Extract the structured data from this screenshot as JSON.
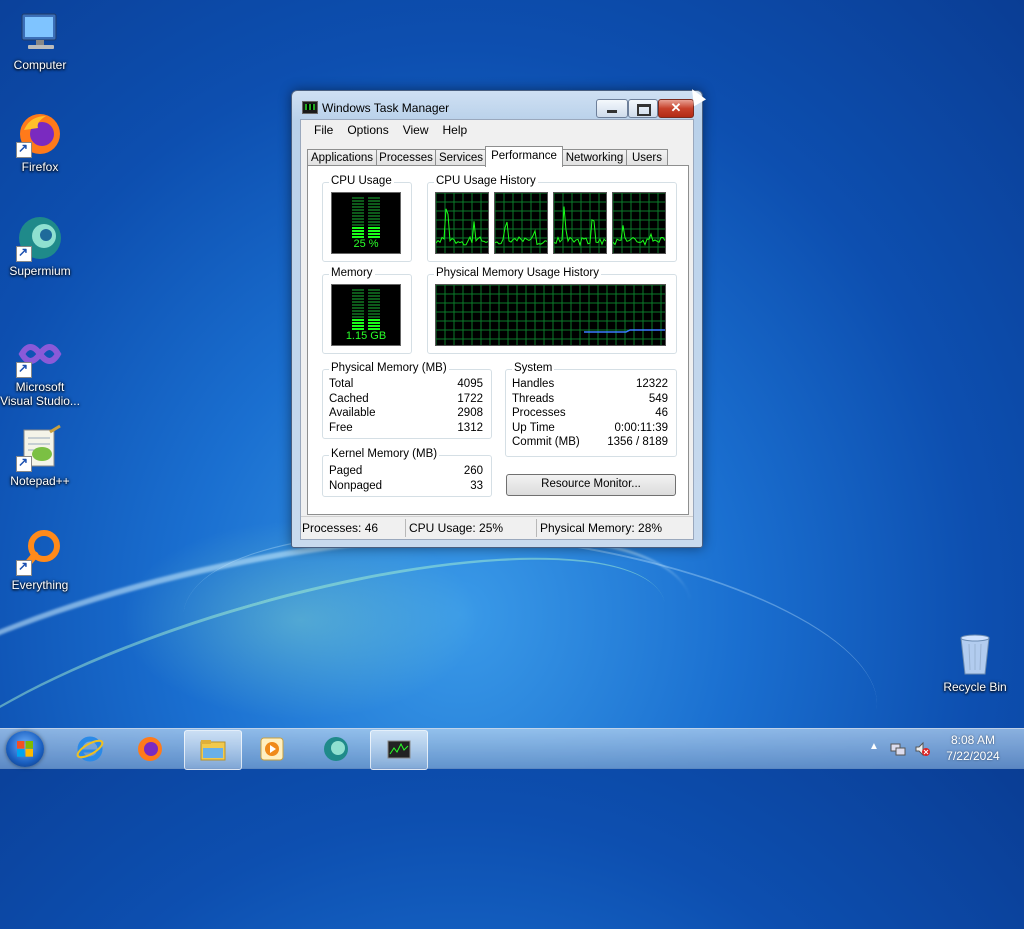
{
  "desktop": {
    "icons": [
      {
        "label": "Computer"
      },
      {
        "label": "Firefox"
      },
      {
        "label": "Supermium"
      },
      {
        "label": "Microsoft Visual Studio..."
      },
      {
        "label": "Notepad++"
      },
      {
        "label": "Everything"
      },
      {
        "label": "Recycle Bin"
      }
    ]
  },
  "window": {
    "title": "Windows Task Manager",
    "menu": [
      "File",
      "Options",
      "View",
      "Help"
    ],
    "tabs": [
      "Applications",
      "Processes",
      "Services",
      "Performance",
      "Networking",
      "Users"
    ],
    "active_tab": "Performance",
    "performance": {
      "cpu_usage_title": "CPU Usage",
      "cpu_usage_value": "25 %",
      "cpu_usage_percent": 25,
      "cpu_history_title": "CPU Usage History",
      "memory_title": "Memory",
      "memory_value": "1.15 GB",
      "memory_percent": 28,
      "memory_history_title": "Physical Memory Usage History",
      "physical_memory": {
        "title": "Physical Memory (MB)",
        "rows": [
          {
            "key": "Total",
            "value": "4095"
          },
          {
            "key": "Cached",
            "value": "1722"
          },
          {
            "key": "Available",
            "value": "2908"
          },
          {
            "key": "Free",
            "value": "1312"
          }
        ]
      },
      "kernel_memory": {
        "title": "Kernel Memory (MB)",
        "rows": [
          {
            "key": "Paged",
            "value": "260"
          },
          {
            "key": "Nonpaged",
            "value": "33"
          }
        ]
      },
      "system": {
        "title": "System",
        "rows": [
          {
            "key": "Handles",
            "value": "12322"
          },
          {
            "key": "Threads",
            "value": "549"
          },
          {
            "key": "Processes",
            "value": "46"
          },
          {
            "key": "Up Time",
            "value": "0:00:11:39"
          },
          {
            "key": "Commit (MB)",
            "value": "1356 / 8189"
          }
        ]
      },
      "resource_monitor_label": "Resource Monitor..."
    },
    "status": {
      "processes": "Processes: 46",
      "cpu": "CPU Usage: 25%",
      "memory": "Physical Memory: 28%"
    }
  },
  "taskbar": {
    "items": [
      "internet-explorer-icon",
      "firefox-icon",
      "file-explorer-icon",
      "media-player-icon",
      "supermium-icon",
      "task-manager-icon"
    ],
    "clock_time": "8:08 AM",
    "clock_date": "7/22/2024"
  },
  "colors": {
    "graph_green": "#1aff1a",
    "grid_green": "#0b7a2a",
    "memory_line": "#3a7bff"
  }
}
